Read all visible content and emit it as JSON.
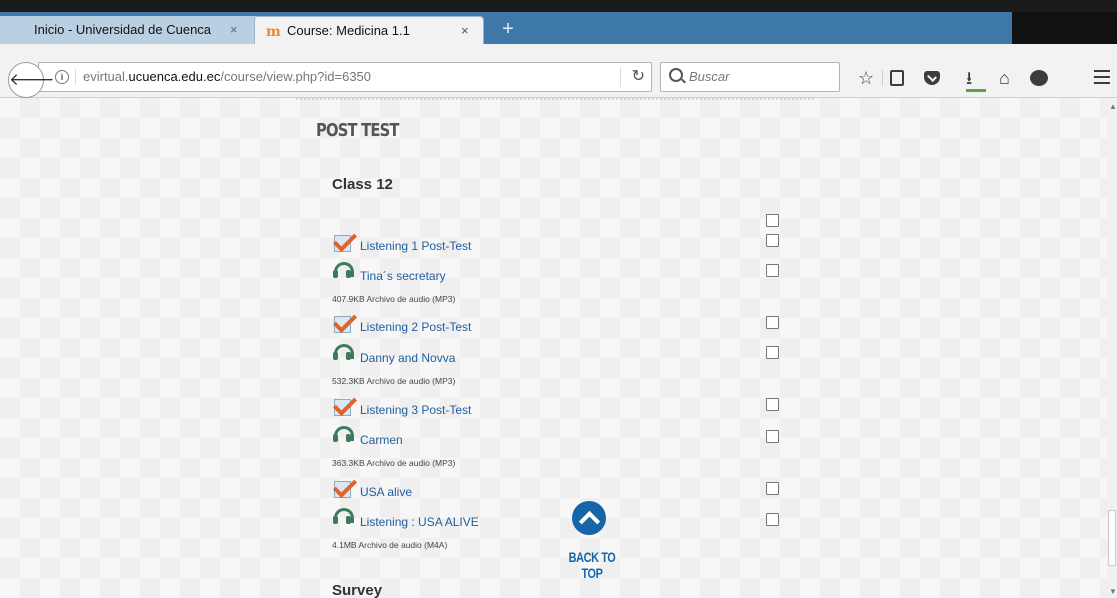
{
  "browser": {
    "tabs": [
      {
        "title": "Inicio - Universidad de Cuenca",
        "close": "×"
      },
      {
        "title": "Course: Medicina 1.1",
        "close": "×",
        "favicon": "m"
      }
    ],
    "new_tab": "+",
    "url_prefix": "evirtual.",
    "url_domain": "ucuenca.edu.ec",
    "url_path": "/course/view.php?id=6350",
    "search_placeholder": "Buscar",
    "icons": {
      "back": "back-arrow-icon",
      "info": "info-icon",
      "reload": "reload-icon",
      "search": "search-icon",
      "bookmark": "star-icon",
      "reading_list": "reading-list-icon",
      "pocket": "pocket-icon",
      "download": "download-icon",
      "home": "home-icon",
      "chat": "chat-icon",
      "menu": "hamburger-menu-icon"
    }
  },
  "page": {
    "section_title": "POST TEST",
    "class_title": "Class 12",
    "activities": [
      {
        "type": "quiz",
        "label": "Listening 1 Post-Test",
        "meta": ""
      },
      {
        "type": "audio",
        "label": "Tina´s secretary",
        "meta": "407.9KB Archivo de audio (MP3)"
      },
      {
        "type": "quiz",
        "label": "Listening 2 Post-Test",
        "meta": ""
      },
      {
        "type": "audio",
        "label": "Danny and Novva",
        "meta": "532.3KB Archivo de audio (MP3)"
      },
      {
        "type": "quiz",
        "label": "Listening 3 Post-Test",
        "meta": ""
      },
      {
        "type": "audio",
        "label": "Carmen",
        "meta": "363.3KB Archivo de audio (MP3)"
      },
      {
        "type": "quiz",
        "label": "USA alive",
        "meta": ""
      },
      {
        "type": "audio",
        "label": "Listening : USA ALIVE",
        "meta": "4.1MB Archivo de audio (M4A)"
      }
    ],
    "back_to_top": "BACK TO TOP",
    "next_section": "Survey"
  },
  "colors": {
    "tab_strip": "#3d78a8",
    "link": "#1f5e9e",
    "back_to_top": "#1565a8",
    "quiz_tick": "#e1622a",
    "audio_icon": "#3b7a5a"
  }
}
